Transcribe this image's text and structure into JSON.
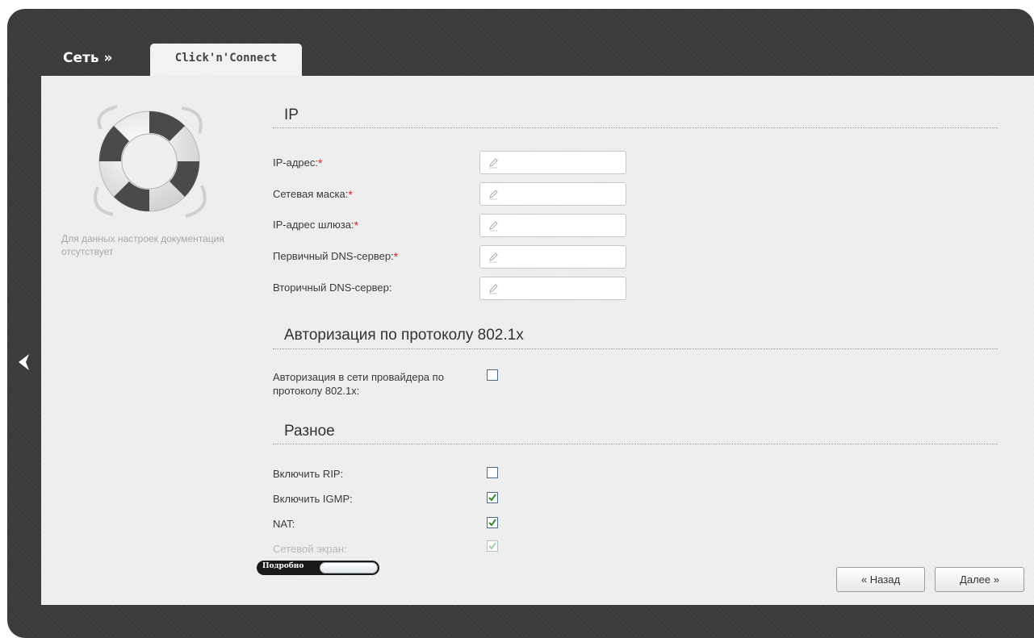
{
  "header": {
    "breadcrumb": "Сеть »",
    "tab_label": "Click'n'Connect"
  },
  "sidebar": {
    "doc_note": "Для данных настроек документация отсутствует"
  },
  "sections": {
    "ip": {
      "title": "IP",
      "fields": [
        {
          "label": "IP-адрес:",
          "required": "*",
          "value": "",
          "placeholder": ""
        },
        {
          "label": "Сетевая маска:",
          "required": "*",
          "value": "",
          "placeholder": ""
        },
        {
          "label": "IP-адрес шлюза:",
          "required": "*",
          "value": "",
          "placeholder": ""
        },
        {
          "label": "Первичный DNS-сервер:",
          "required": "*",
          "value": "",
          "placeholder": ""
        },
        {
          "label": "Вторичный DNS-сервер:",
          "required": "",
          "value": "",
          "placeholder": ""
        }
      ]
    },
    "auth": {
      "title": "Авторизация по протоколу 802.1x",
      "label_line1": "Авторизация в сети провайдера по",
      "label_line2": "протоколу 802.1x:",
      "checked": false
    },
    "misc": {
      "title": "Разное",
      "options": [
        {
          "label": "Включить RIP:",
          "checked": false
        },
        {
          "label": "Включить IGMP:",
          "checked": true
        },
        {
          "label": "NAT:",
          "checked": true
        },
        {
          "label": "Сетевой экран:",
          "checked": true
        }
      ]
    }
  },
  "toggle": {
    "label": "Подробно"
  },
  "buttons": {
    "back": "« Назад",
    "next": "Далее »"
  },
  "colors": {
    "frame": "#3a3a3a",
    "panel": "#efefef",
    "required": "#e02020",
    "check": "#2e8b2e"
  }
}
